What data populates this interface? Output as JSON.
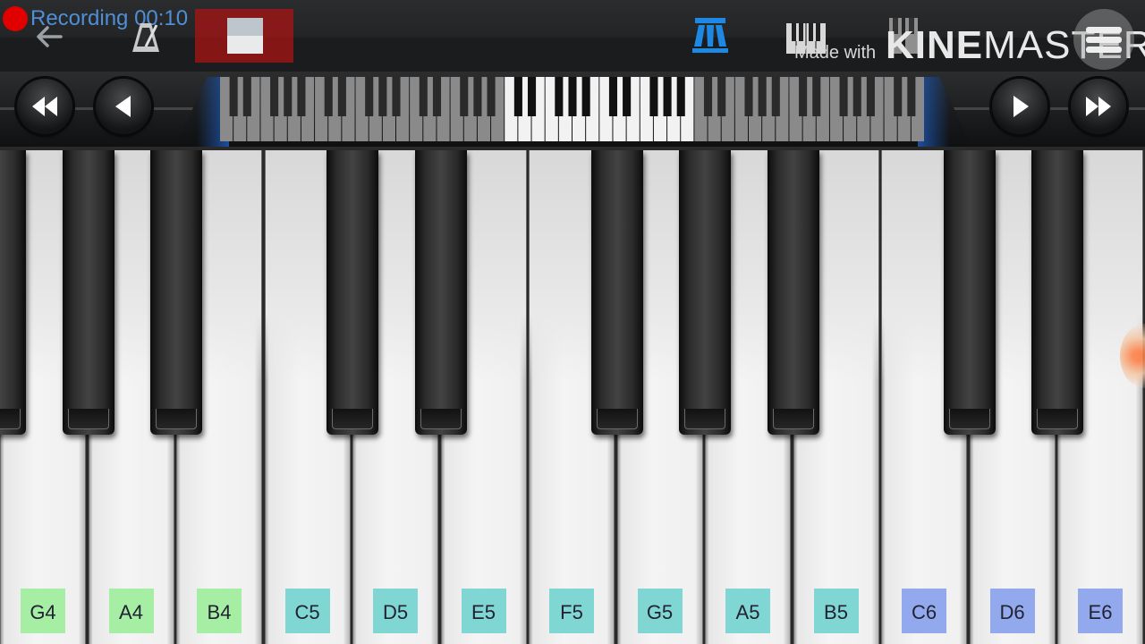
{
  "recording": {
    "label": "Recording 00:10",
    "indicator_color": "#e00000"
  },
  "toolbar": {
    "back_icon": "back-arrow-icon",
    "metronome_icon": "metronome-icon",
    "stop_icon": "stop-recording-icon",
    "mode_icon": "single-row-mode-icon",
    "keyboard_icon": "keyboard-icon",
    "dual_icon": "dual-row-mode-icon",
    "menu_icon": "menu-icon",
    "accent_color": "#1e88e5"
  },
  "watermark": {
    "small": "Made with",
    "brand_bold": "KINE",
    "brand_rest": "MASTER"
  },
  "navigation": {
    "rewind_icon": "fast-rewind-icon",
    "prev_icon": "step-back-icon",
    "next_icon": "step-forward-icon",
    "forward_icon": "fast-forward-icon"
  },
  "keyboard": {
    "white_keys": [
      {
        "note": "G4",
        "label_color": "#a6eea4"
      },
      {
        "note": "A4",
        "label_color": "#a6eea4"
      },
      {
        "note": "B4",
        "label_color": "#a6eea4"
      },
      {
        "note": "C5",
        "label_color": "#7fd6d3"
      },
      {
        "note": "D5",
        "label_color": "#7fd6d3"
      },
      {
        "note": "E5",
        "label_color": "#7fd6d3"
      },
      {
        "note": "F5",
        "label_color": "#7fd6d3"
      },
      {
        "note": "G5",
        "label_color": "#7fd6d3"
      },
      {
        "note": "A5",
        "label_color": "#7fd6d3"
      },
      {
        "note": "B5",
        "label_color": "#7fd6d3"
      },
      {
        "note": "C6",
        "label_color": "#92a9ee"
      },
      {
        "note": "D6",
        "label_color": "#92a9ee"
      },
      {
        "note": "E6",
        "label_color": "#92a9ee"
      }
    ]
  }
}
